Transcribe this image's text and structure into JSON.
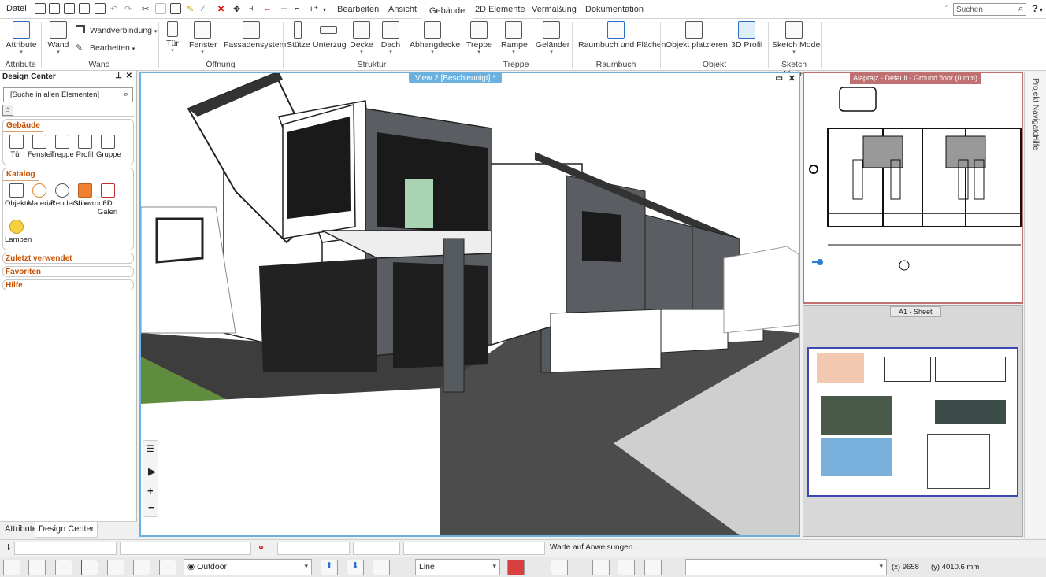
{
  "quickbar": {
    "file_menu": "Datei",
    "search_placeholder": "Suchen",
    "help": "?"
  },
  "tabs": [
    "Bearbeiten",
    "Ansicht",
    "Gebäude",
    "2D Elemente",
    "Vermaßung",
    "Dokumentation"
  ],
  "ribbon": {
    "attribute_btn": "Attribute",
    "wand_btn": "Wand",
    "wandverbindung": "Wandverbindung",
    "bearbeiten": "Bearbeiten",
    "tuer": "Tür",
    "fenster": "Fenster",
    "fassadensystem": "Fassadensystem",
    "stuetze": "Stütze",
    "unterzug": "Unterzug",
    "decke": "Decke",
    "dach": "Dach",
    "abhangdecke": "Abhangdecke",
    "treppe": "Treppe",
    "rampe": "Rampe",
    "gelaender": "Geländer",
    "raumbuch_flaechen": "Raumbuch und Flächen",
    "objekt_platzieren": "Objekt platzieren",
    "profil3d": "3D Profil",
    "sketch_mode": "Sketch Mode",
    "groups": {
      "attribute": "Attribute",
      "wand": "Wand",
      "oeffnung": "Öffnung",
      "struktur": "Struktur",
      "treppe": "Treppe",
      "raumbuch": "Raumbuch",
      "objekt": "Objekt",
      "sketch": "Sketch Mode"
    }
  },
  "design_center": {
    "title": "Design Center",
    "search_placeholder": "[Suche in allen Elementen]",
    "gebaeude_head": "Gebäude",
    "gebaeude_items": [
      "Tür",
      "Fenster",
      "Treppe",
      "Profil",
      "Gruppe"
    ],
    "katalog_head": "Katalog",
    "katalog_items": [
      "Objekte",
      "Material",
      "Renderstile",
      "Showroom",
      "3D Galeri",
      "Lampen"
    ],
    "recent": "Zuletzt verwendet",
    "favorites": "Favoriten",
    "help": "Hilfe",
    "bottom_tabs": [
      "Attribute",
      "Design Center"
    ]
  },
  "view3d": {
    "title": "View 2 [Beschleunigt] *"
  },
  "plan": {
    "title": "Alaprajz - Default - Ground floor (0 mm)"
  },
  "sheet": {
    "title": "A1 - Sheet"
  },
  "right_nav": {
    "navigator": "Projekt Navigator",
    "hilfe": "Hilfe"
  },
  "command_line": {
    "prompt": "Warte auf Anweisungen..."
  },
  "status": {
    "layer_view": "Outdoor",
    "line_type": "Line",
    "x_coord": "(x) 9658",
    "y_coord": "(y) 4010.6 mm"
  },
  "colors": {
    "accent": "#6cb0df",
    "brick": "#555a5e",
    "plan_frame": "#c07070",
    "section_orange": "#c85000"
  }
}
